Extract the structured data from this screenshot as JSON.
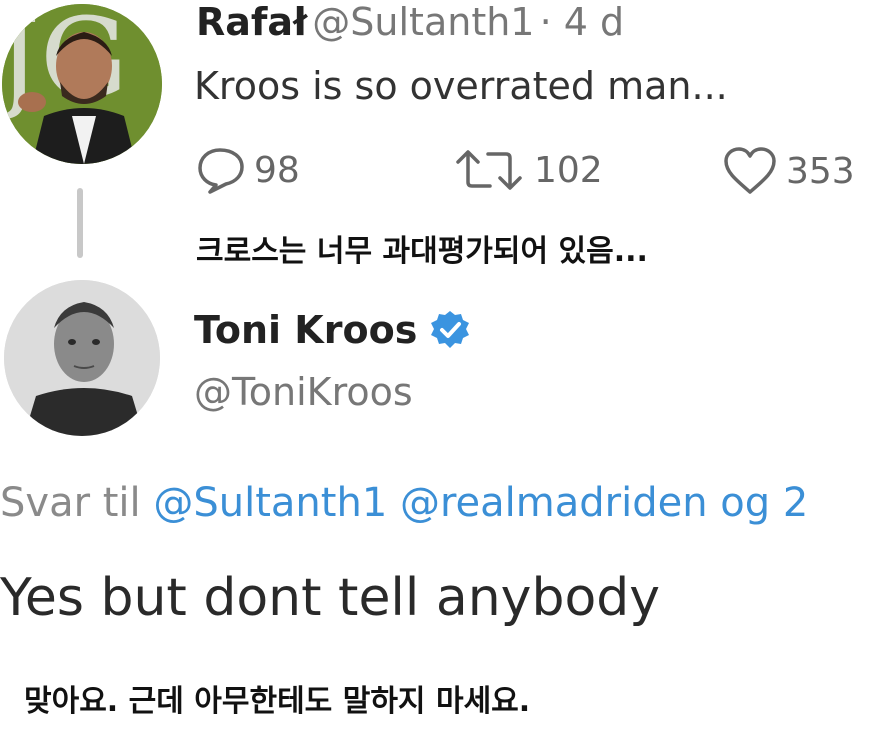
{
  "tweet1": {
    "display_name": "Rafał",
    "handle": "@Sultanth1",
    "time": "· 4 d",
    "text": "Kroos is so overrated man...",
    "replies": "98",
    "retweets": "102",
    "likes": "353"
  },
  "caption1": "크로스는 너무 과대평가되어 있음...",
  "tweet2": {
    "display_name": "Toni Kroos",
    "handle": "@ToniKroos",
    "reply_label": "Svar til",
    "reply_mentions": "@Sultanth1 @realmadriden og 2",
    "text": "Yes but dont tell anybody"
  },
  "caption2": "맞아요. 근데 아무한테도 말하지 마세요.",
  "colors": {
    "verified": "#3b94e0",
    "mention": "#3b8fd6",
    "avatar1_bg": "#6f8f2f"
  },
  "icons": [
    "reply-icon",
    "retweet-icon",
    "like-icon",
    "verified-badge-icon"
  ]
}
